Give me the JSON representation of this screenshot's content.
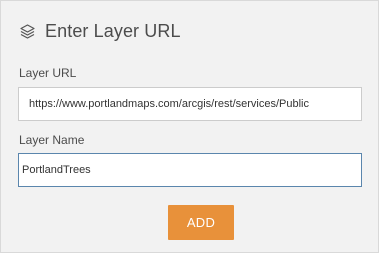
{
  "header": {
    "title": "Enter Layer URL",
    "icon": "layers-icon"
  },
  "form": {
    "url_label": "Layer URL",
    "url_value": "https://www.portlandmaps.com/arcgis/rest/services/Public",
    "name_label": "Layer Name",
    "name_value": "PortlandTrees",
    "add_label": "ADD"
  },
  "colors": {
    "panel_background": "#f2f2f2",
    "button_accent": "#e8913a",
    "focused_border": "#5b86ad"
  }
}
